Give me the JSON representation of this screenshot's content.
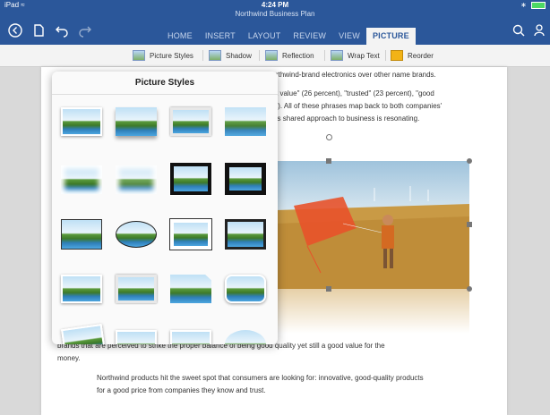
{
  "status": {
    "device": "iPad",
    "wifi": "wifi-icon",
    "time": "4:24 PM",
    "battery_icon": "battery-icon"
  },
  "document_title": "Northwind Business Plan",
  "toolbar_icons": [
    "back-icon",
    "file-icon",
    "undo-icon",
    "redo-icon",
    "search-icon",
    "share-user-icon"
  ],
  "tabs": [
    {
      "label": "HOME",
      "active": false
    },
    {
      "label": "INSERT",
      "active": false
    },
    {
      "label": "LAYOUT",
      "active": false
    },
    {
      "label": "REVIEW",
      "active": false
    },
    {
      "label": "VIEW",
      "active": false
    },
    {
      "label": "PICTURE",
      "active": true
    }
  ],
  "ribbon": {
    "picture_styles": "Picture Styles",
    "shadow": "Shadow",
    "reflection": "Reflection",
    "wrap_text": "Wrap Text",
    "reorder": "Reorder"
  },
  "popover": {
    "title": "Picture Styles"
  },
  "doc": {
    "line1_tail": "rthwind-brand electronics over other name brands.",
    "line2_tail": "t value\" (26 percent), \"trusted\" (23 percent), \"good",
    "line3_tail": "t). All of these phrases map back to both companies'",
    "line4_tail": "'s shared approach to business is resonating.",
    "para2_line1": "brands that are perceived to strike the proper balance of being good quality yet still a good value for the",
    "para2_line2": "money.",
    "para3_line1": "Northwind products hit the sweet spot that consumers are looking for: innovative, good-quality products",
    "para3_line2": "for a good price from companies they know and trust."
  },
  "colors": {
    "ribbon_blue": "#2b579a",
    "canvas": "#d9d9d9",
    "active_tab_text": "#2b579a"
  }
}
